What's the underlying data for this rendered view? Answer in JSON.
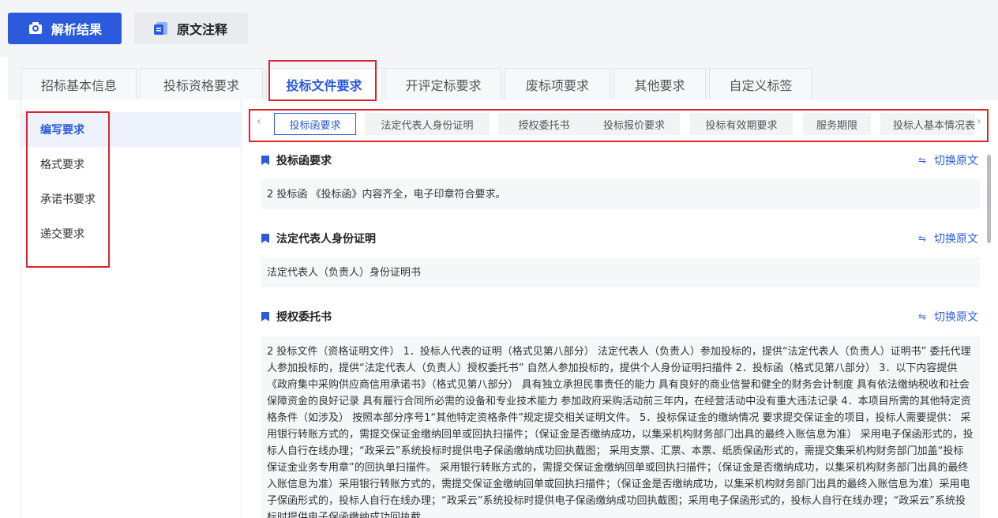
{
  "header": {
    "primary_button": "解析结果",
    "secondary_button": "原文注释"
  },
  "main_tabs": [
    "招标基本信息",
    "投标资格要求",
    "投标文件要求",
    "开评定标要求",
    "废标项要求",
    "其他要求",
    "自定义标签"
  ],
  "sidebar": {
    "items": [
      "编写要求",
      "格式要求",
      "承诺书要求",
      "递交要求"
    ]
  },
  "sub_tabs": [
    "投标函要求",
    "法定代表人身份证明",
    "授权委托书",
    "投标报价要求",
    "投标有效期要求",
    "服务期限",
    "投标人基本情况表"
  ],
  "switch_label": "切换原文",
  "sections": [
    {
      "title": "投标函要求",
      "content": "2 投标函 《投标函》内容齐全，电子印章符合要求。"
    },
    {
      "title": "法定代表人身份证明",
      "content": "法定代表人（负责人）身份证明书"
    },
    {
      "title": "授权委托书",
      "content": "2 投标文件（资格证明文件） 1．投标人代表的证明（格式见第八部分） 法定代表人（负责人）参加投标的，提供“法定代表人（负责人）证明书” 委托代理人参加投标的，提供“法定代表人（负责人）授权委托书” 自然人参加投标的，提供个人身份证明扫描件 2．投标函（格式见第八部分） 3．以下内容提供《政府集中采购供应商信用承诺书》（格式见第八部分） 具有独立承担民事责任的能力 具有良好的商业信誉和健全的财务会计制度 具有依法缴纳税收和社会保障资金的良好记录 具有履行合同所必需的设备和专业技术能力 参加政府采购活动前三年内，在经营活动中没有重大违法记录 4．本项目所需的其他特定资格条件（如涉及） 按照本部分序号1“其他特定资格条件”规定提交相关证明文件。 5．投标保证金的缴纳情况 要求提交保证金的项目，投标人需要提供： 采用银行转账方式的，需提交保证金缴纳回单或回执扫描件；（保证金是否缴纳成功，以集采机构财务部门出具的最终入账信息为准） 采用电子保函形式的，投标人自行在线办理；“政采云”系统投标时提供电子保函缴纳成功回执截图； 采用支票、汇票、本票、纸质保函形式的，需提交集采机构财务部门加盖“投标保证金业务专用章”的回执单扫描件。 采用银行转账方式的，需提交保证金缴纳回单或回执扫描件；（保证金是否缴纳成功，以集采机构财务部门出具的最终入账信息为准）采用银行转账方式的，需提交保证金缴纳回单或回执扫描件；（保证金是否缴纳成功，以集采机构财务部门出具的最终入账信息为准）采用电子保函形式的，投标人自行在线办理；“政采云”系统投标时提供电子保函缴纳成功回执截图；采用电子保函形式的，投标人自行在线办理；“政采云”系统投标时提供电子保函缴纳成功回执截"
    }
  ]
}
